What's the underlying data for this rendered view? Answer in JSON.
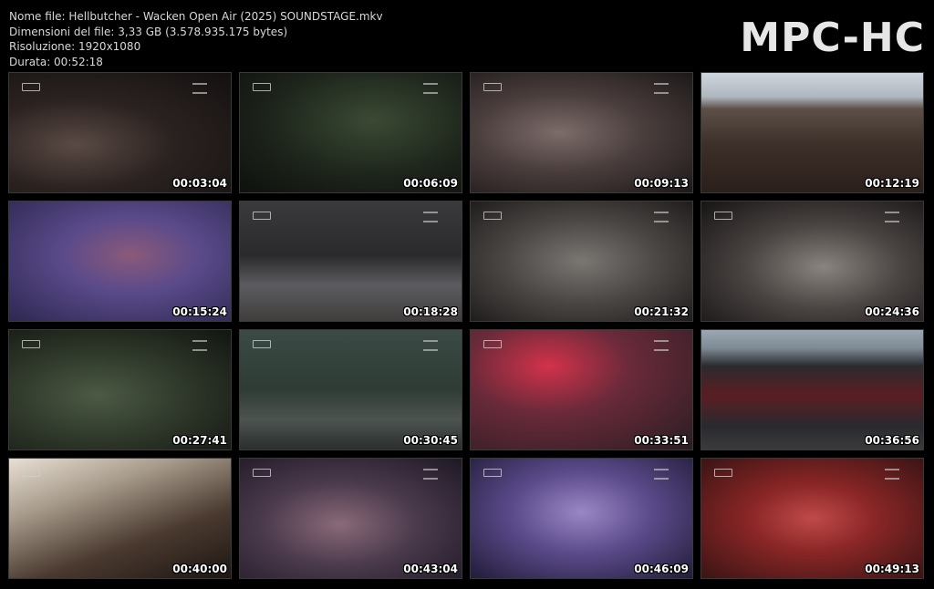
{
  "file_info": {
    "name": "Nome file: Hellbutcher - Wacken Open Air (2025) SOUNDSTAGE.mkv",
    "size": "Dimensioni del file: 3,33 GB (3.578.935.175 bytes)",
    "resolution": "Risoluzione: 1920x1080",
    "duration": "Durata: 00:52:18"
  },
  "brand": "MPC-HC",
  "thumbnails": [
    {
      "time": "00:03:04"
    },
    {
      "time": "00:06:09"
    },
    {
      "time": "00:09:13"
    },
    {
      "time": "00:12:19"
    },
    {
      "time": "00:15:24"
    },
    {
      "time": "00:18:28"
    },
    {
      "time": "00:21:32"
    },
    {
      "time": "00:24:36"
    },
    {
      "time": "00:27:41"
    },
    {
      "time": "00:30:45"
    },
    {
      "time": "00:33:51"
    },
    {
      "time": "00:36:56"
    },
    {
      "time": "00:40:00"
    },
    {
      "time": "00:43:04"
    },
    {
      "time": "00:46:09"
    },
    {
      "time": "00:49:13"
    }
  ]
}
